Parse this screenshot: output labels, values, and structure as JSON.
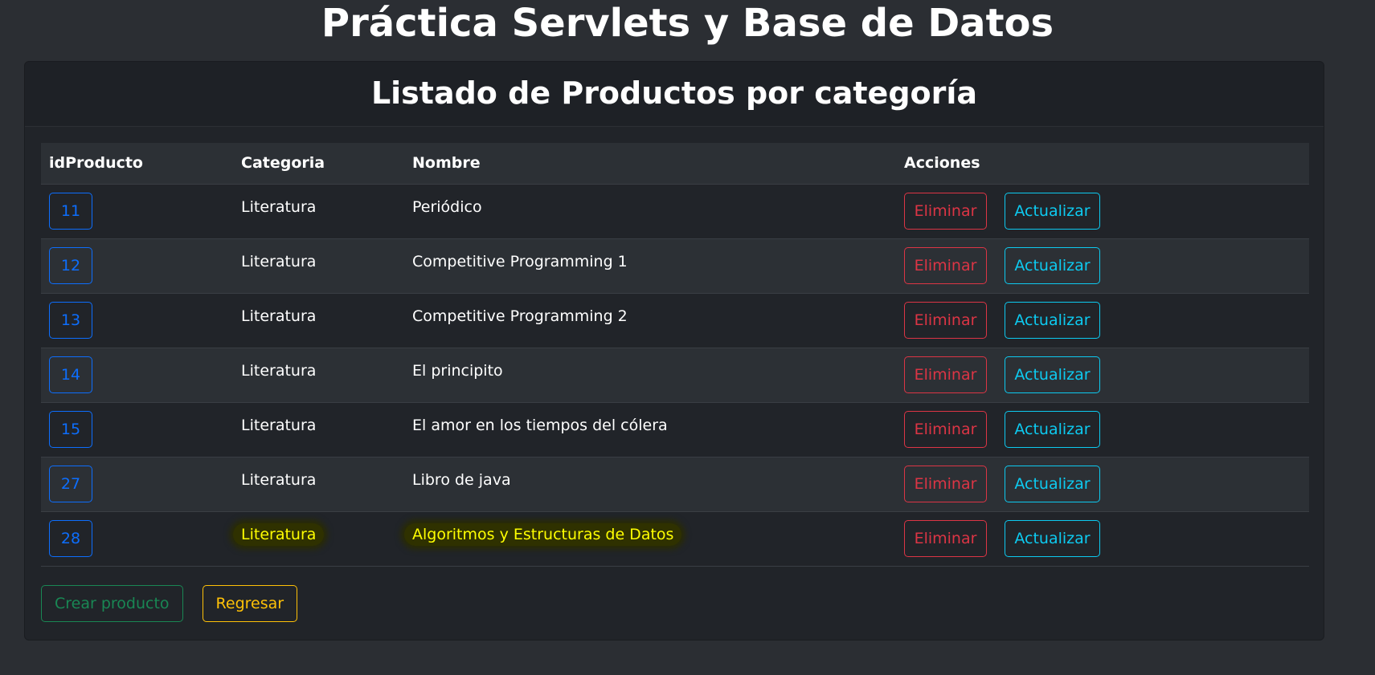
{
  "page": {
    "title": "Práctica Servlets y Base de Datos"
  },
  "card": {
    "header": "Listado de Productos por categoría"
  },
  "table": {
    "headers": [
      "idProducto",
      "Categoria",
      "Nombre",
      "Acciones"
    ],
    "rows": [
      {
        "id": "11",
        "categoria": "Literatura",
        "nombre": "Periódico",
        "eliminar": "Eliminar",
        "actualizar": "Actualizar"
      },
      {
        "id": "12",
        "categoria": "Literatura",
        "nombre": "Competitive Programming 1",
        "eliminar": "Eliminar",
        "actualizar": "Actualizar"
      },
      {
        "id": "13",
        "categoria": "Literatura",
        "nombre": "Competitive Programming 2",
        "eliminar": "Eliminar",
        "actualizar": "Actualizar"
      },
      {
        "id": "14",
        "categoria": "Literatura",
        "nombre": "El principito",
        "eliminar": "Eliminar",
        "actualizar": "Actualizar"
      },
      {
        "id": "15",
        "categoria": "Literatura",
        "nombre": "El amor en los tiempos del cólera",
        "eliminar": "Eliminar",
        "actualizar": "Actualizar"
      },
      {
        "id": "27",
        "categoria": "Literatura",
        "nombre": "Libro de java",
        "eliminar": "Eliminar",
        "actualizar": "Actualizar"
      },
      {
        "id": "28",
        "categoria": "Literatura",
        "nombre": "Algoritmos y Estructuras de Datos",
        "eliminar": "Eliminar",
        "actualizar": "Actualizar"
      }
    ]
  },
  "footer": {
    "create_label": "Crear producto",
    "back_label": "Regresar"
  },
  "colors": {
    "primary": "#0d6efd",
    "danger": "#dc3545",
    "info": "#0dcaf0",
    "success": "#198754",
    "warning": "#ffc107",
    "highlight": "#ffff00"
  }
}
